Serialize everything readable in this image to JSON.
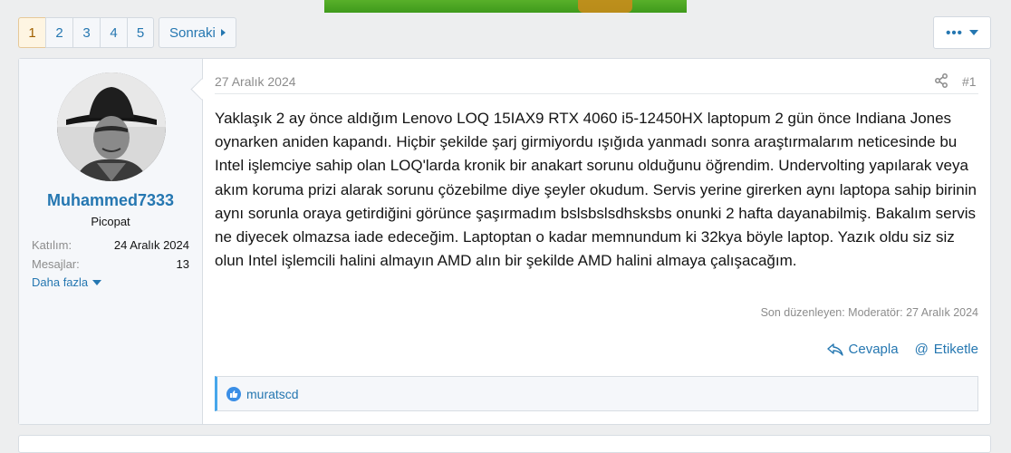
{
  "pagination": {
    "pages": [
      "1",
      "2",
      "3",
      "4",
      "5"
    ],
    "current": "1",
    "next_label": "Sonraki"
  },
  "more_menu": {
    "label": "•••"
  },
  "post": {
    "user": {
      "name": "Muhammed7333",
      "title": "Picopat",
      "stats": [
        {
          "label": "Katılım:",
          "value": "24 Aralık 2024"
        },
        {
          "label": "Mesajlar:",
          "value": "13"
        }
      ],
      "more_label": "Daha fazla"
    },
    "date": "27 Aralık 2024",
    "number": "#1",
    "body": "Yaklaşık 2 ay önce aldığım Lenovo LOQ 15IAX9 RTX 4060 i5-12450HX laptopum 2 gün önce Indiana Jones oynarken aniden kapandı. Hiçbir şekilde şarj girmiyordu ışığıda yanmadı sonra araştırmalarım neticesinde bu Intel işlemciye sahip olan LOQ'larda kronik bir anakart sorunu olduğunu öğrendim. Undervolting yapılarak veya akım koruma prizi alarak sorunu çözebilme diye şeyler okudum. Servis yerine girerken aynı laptopa sahip birinin aynı sorunla oraya getirdiğini görünce şaşırmadım bslsbslsdhsksbs onunki 2 hafta dayanabilmiş. Bakalım servis ne diyecek olmazsa iade edeceğim. Laptoptan o kadar memnundum ki 32kya böyle laptop. Yazık oldu siz siz olun Intel işlemcili halini almayın AMD alın bir şekilde AMD halini almaya çalışacağım.",
    "edited": "Son düzenleyen: Moderatör: 27 Aralık 2024",
    "actions": {
      "reply": "Cevapla",
      "mention": "Etiketle"
    },
    "reactions": {
      "user": "muratscd"
    }
  },
  "colors": {
    "link": "#2577b1",
    "accent": "#47a7eb",
    "current_page_bg": "#fef5e2"
  }
}
